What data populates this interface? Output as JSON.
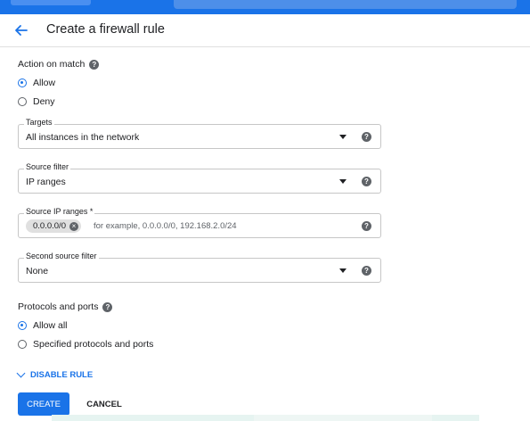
{
  "header": {
    "title": "Create a firewall rule"
  },
  "action_on_match": {
    "label": "Action on match",
    "options": [
      {
        "label": "Allow",
        "selected": true
      },
      {
        "label": "Deny",
        "selected": false
      }
    ]
  },
  "targets": {
    "label": "Targets",
    "value": "All instances in the network"
  },
  "source_filter": {
    "label": "Source filter",
    "value": "IP ranges"
  },
  "source_ip_ranges": {
    "label": "Source IP ranges *",
    "chip": "0.0.0.0/0",
    "placeholder": "for example, 0.0.0.0/0, 192.168.2.0/24"
  },
  "second_source_filter": {
    "label": "Second source filter",
    "value": "None"
  },
  "protocols_and_ports": {
    "label": "Protocols and ports",
    "options": [
      {
        "label": "Allow all",
        "selected": true
      },
      {
        "label": "Specified protocols and ports",
        "selected": false
      }
    ]
  },
  "disable_rule": {
    "label": "DISABLE RULE"
  },
  "buttons": {
    "create": "CREATE",
    "cancel": "CANCEL"
  },
  "help_icon_glyph": "?",
  "colors": {
    "accent": "#1a73e8",
    "text": "#202124",
    "muted": "#5f6368"
  }
}
